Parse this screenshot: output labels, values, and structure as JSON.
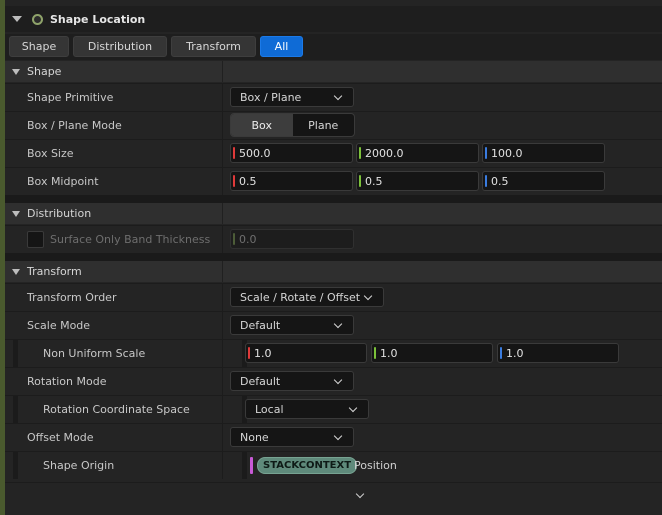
{
  "header": {
    "title": "Shape Location"
  },
  "tabs": [
    {
      "label": "Shape"
    },
    {
      "label": "Distribution"
    },
    {
      "label": "Transform"
    },
    {
      "label": "All",
      "active": true
    }
  ],
  "sections": {
    "shape": {
      "label": "Shape",
      "shape_primitive": {
        "label": "Shape Primitive",
        "value": "Box / Plane"
      },
      "mode": {
        "label": "Box / Plane Mode",
        "options": [
          "Box",
          "Plane"
        ],
        "selected": "Box"
      },
      "box_size": {
        "label": "Box Size",
        "x": "500.0",
        "y": "2000.0",
        "z": "100.0"
      },
      "box_midpoint": {
        "label": "Box Midpoint",
        "x": "0.5",
        "y": "0.5",
        "z": "0.5"
      }
    },
    "distribution": {
      "label": "Distribution",
      "band": {
        "label": "Surface Only Band Thickness",
        "value": "0.0",
        "enabled": false
      }
    },
    "transform": {
      "label": "Transform",
      "order": {
        "label": "Transform Order",
        "value": "Scale / Rotate / Offset"
      },
      "scale_mode": {
        "label": "Scale Mode",
        "value": "Default"
      },
      "non_uniform": {
        "label": "Non Uniform Scale",
        "x": "1.0",
        "y": "1.0",
        "z": "1.0"
      },
      "rotation_mode": {
        "label": "Rotation Mode",
        "value": "Default"
      },
      "rotation_space": {
        "label": "Rotation Coordinate Space",
        "value": "Local"
      },
      "offset_mode": {
        "label": "Offset Mode",
        "value": "None"
      },
      "shape_origin": {
        "label": "Shape Origin",
        "pill": "STACKCONTEXT",
        "suffix": "Position"
      }
    }
  },
  "colors": {
    "x_axis": "#e03a3a",
    "y_axis": "#7cc23a",
    "z_axis": "#3a7ce0",
    "active_tab": "#0f6bd6",
    "pill": "#5f8a7b"
  }
}
